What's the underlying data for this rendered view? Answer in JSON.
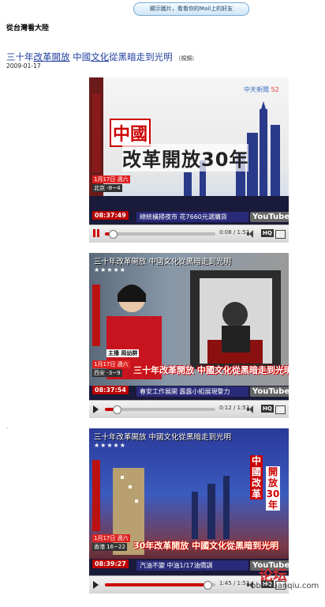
{
  "top_button": "顯示圖片，看看你的Mail上的好友",
  "header": "從台灣看大陸",
  "article": {
    "title_part1": "三十年",
    "title_link1": "改革開放",
    "title_part2": " 中國",
    "title_link2": "文化",
    "title_part3": "從黑暗走到光明",
    "original_tag": "（視頻）",
    "date": "2009-01-17"
  },
  "videos": [
    {
      "channel": "中天新聞",
      "channel_num": "52",
      "headline_small": "中國",
      "headline_big": "改革開放30年",
      "date_chip": "1月17日 週六",
      "weather": "北京 -8~4",
      "clock": "08:37:49",
      "ticker": "總統橫掃夜市 花7660元選購貨",
      "time_display": "0:08 / 1:53",
      "progress_pct": 7,
      "state": "playing"
    },
    {
      "overlay_title": "三十年改革開放 中國文化從黑暗走到光明",
      "stars": "★★★★★",
      "anchor_tag": "主播 周幼群",
      "date_chip": "1月17日 週六",
      "weather": "西安 -3~9",
      "clock": "08:37:54",
      "ticker": "春安工作展開 露露小組展現警力",
      "slogan": "三十年改革開放 中國文化從黑暗走到光明",
      "time_display": "0:12 / 1:53",
      "progress_pct": 11,
      "state": "paused"
    },
    {
      "overlay_title": "三十年改革開放 中國文化從黑暗走到光明",
      "stars": "★★★★★",
      "vertical_text": "開放30年",
      "vertical_text2": "中國改革",
      "date_chip": "1月17日 週六",
      "weather": "香港 16~22",
      "clock": "08:39:27",
      "ticker": "汽油不變 中油1/17油價調",
      "slogan": "30年改革開放 中國文化從黑暗到光明",
      "time_display": "1:45 / 1:53",
      "progress_pct": 93,
      "state": "paused"
    }
  ],
  "youtube_label": "YouTube",
  "hq_label": "HQ",
  "watermark": {
    "logo": "论坛",
    "url": "bbs.huanqiu.com"
  },
  "colors": {
    "accent_blue": "#1f3f9f",
    "news_red": "#c00000",
    "control_red": "#cc0000"
  }
}
